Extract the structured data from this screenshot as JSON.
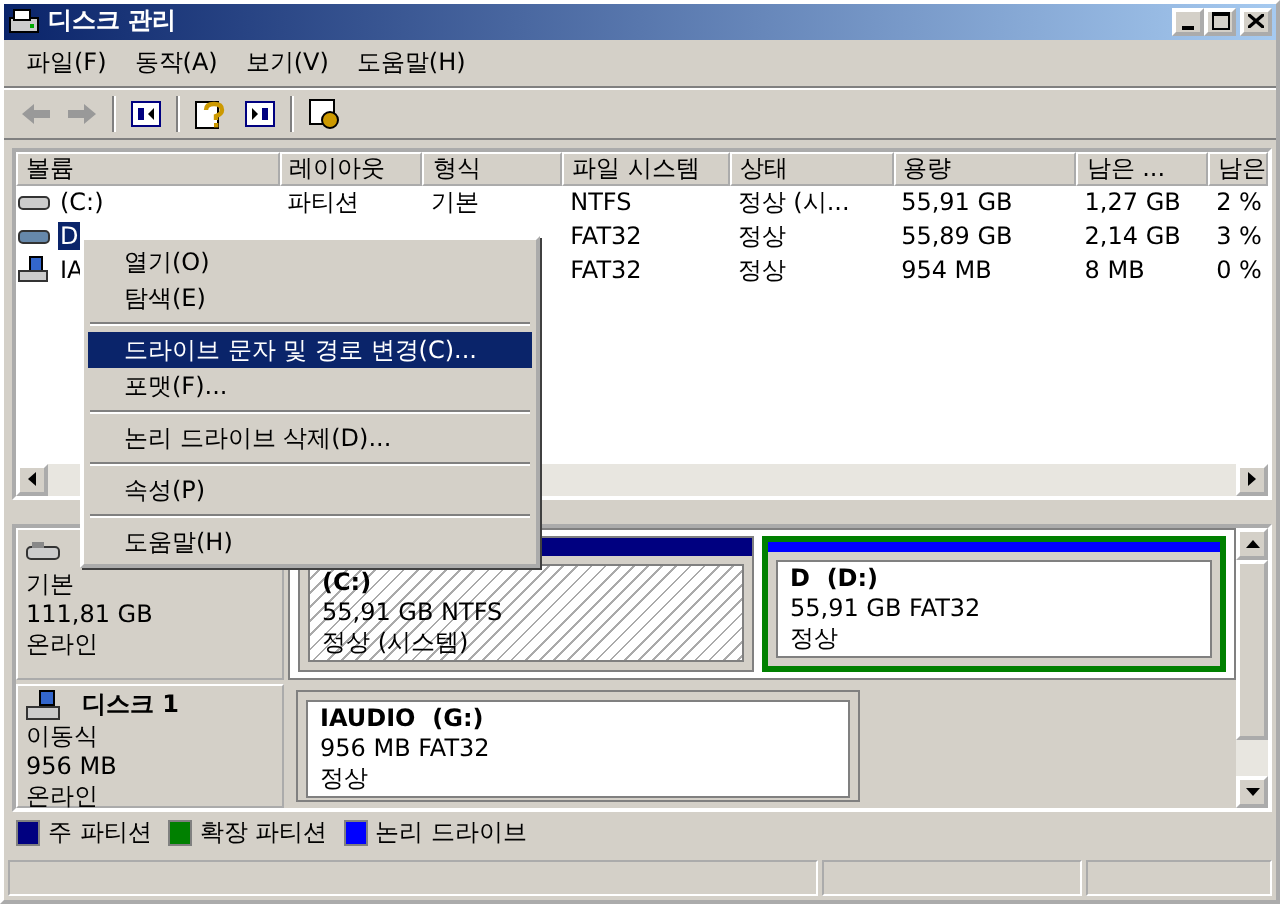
{
  "window": {
    "title": "디스크 관리"
  },
  "menu_bar": [
    "파일(F)",
    "동작(A)",
    "보기(V)",
    "도움말(H)"
  ],
  "volume_list": {
    "columns": [
      "볼륨",
      "레이아웃",
      "형식",
      "파일 시스템",
      "상태",
      "용량",
      "남은 ...",
      "남은"
    ],
    "rows": [
      {
        "kind": "fixed",
        "volume": "(C:)",
        "layout": "파티션",
        "type": "기본",
        "file_system": "NTFS",
        "status": "정상 (시...",
        "capacity": "55,91 GB",
        "free": "1,27 GB",
        "free_pct": "2 %",
        "selected": false
      },
      {
        "kind": "fixed",
        "volume": "D",
        "file_system": "FAT32",
        "status": "정상",
        "capacity": "55,89 GB",
        "free": "2,14 GB",
        "free_pct": "3 %",
        "selected": true
      },
      {
        "kind": "removable",
        "volume": "IA",
        "file_system": "FAT32",
        "status": "정상",
        "capacity": "954 MB",
        "free": "8 MB",
        "free_pct": "0 %",
        "selected": false
      }
    ]
  },
  "context_menu": [
    [
      {
        "label": "열기(O)",
        "selected": false
      },
      {
        "label": "탐색(E)",
        "selected": false
      }
    ],
    [
      {
        "label": "드라이브 문자 및 경로 변경(C)...",
        "selected": true
      },
      {
        "label": "포맷(F)...",
        "selected": false
      }
    ],
    [
      {
        "label": "논리 드라이브 삭제(D)...",
        "selected": false
      }
    ],
    [
      {
        "label": "속성(P)",
        "selected": false
      }
    ],
    [
      {
        "label": "도움말(H)",
        "selected": false
      }
    ]
  ],
  "disks": [
    {
      "kind": "fixed",
      "type": "기본",
      "size": "111,81 GB",
      "status": "온라인",
      "partitions": [
        {
          "kind": "primary",
          "name": "(C:)",
          "detail": "55,91 GB NTFS",
          "status": "정상 (시스템)",
          "selected": true
        },
        {
          "kind": "logical",
          "name": "D  (D:)",
          "detail": "55,91 GB FAT32",
          "status": "정상",
          "selected": false
        }
      ]
    },
    {
      "kind": "removable",
      "name": "디스크 1",
      "type": "이동식",
      "size": "956 MB",
      "status": "온라인",
      "partitions": [
        {
          "kind": "primary",
          "name": "IAUDIO  (G:)",
          "detail": "956 MB FAT32",
          "status": "정상",
          "selected": false
        }
      ]
    }
  ],
  "legend": [
    {
      "label": "주 파티션",
      "color": "#000080"
    },
    {
      "label": "확장 파티션",
      "color": "#008000"
    },
    {
      "label": "논리 드라이브",
      "color": "#0000ff"
    }
  ]
}
